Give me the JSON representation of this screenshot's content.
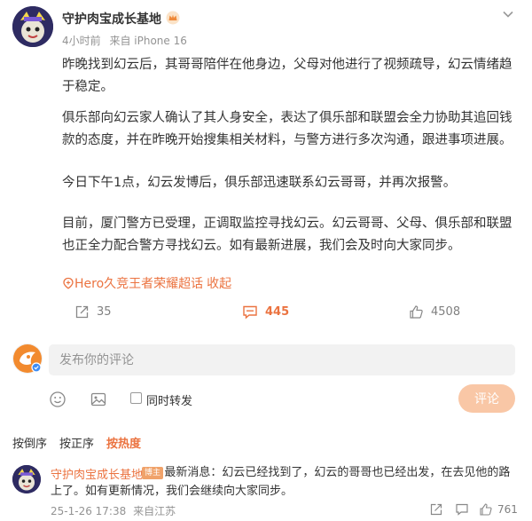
{
  "post": {
    "author": "守护肉宝成长基地",
    "time": "4小时前",
    "source": "来自 iPhone 16",
    "paragraphs": [
      "昨晚找到幻云后，其哥哥陪伴在他身边，父母对他进行了视频疏导，幻云情绪趋于稳定。",
      "俱乐部向幻云家人确认了其人身安全，表达了俱乐部和联盟会全力协助其追回钱款的态度，并在昨晚开始搜集相关材料，与警方进行多次沟通，跟进事项进展。",
      "今日下午1点，幻云发博后，俱乐部迅速联系幻云哥哥，并再次报警。",
      "目前，厦门警方已受理，正调取监控寻找幻云。幻云哥哥、父母、俱乐部和联盟也正全力配合警方寻找幻云。如有最新进展，我们会及时向大家同步。"
    ],
    "topic": "Hero久竞王者荣耀超话",
    "collapse_label": "收起",
    "repost_count": "35",
    "comment_count": "445",
    "like_count": "4508"
  },
  "composer": {
    "placeholder": "发布你的评论",
    "repost_option": "同时转发",
    "submit_label": "评论"
  },
  "sort": {
    "options": [
      "按倒序",
      "按正序",
      "按热度"
    ],
    "active": "按热度"
  },
  "comment": {
    "author": "守护肉宝成长基地",
    "badge": "博主",
    "text": ":最新消息：幻云已经找到了，幻云的哥哥也已经出发，在去见他的路上了。如有更新情况，我们会继续向大家同步。",
    "date": "25-1-26 17:38",
    "location": "来自江苏",
    "like_count": "761"
  },
  "colors": {
    "accent": "#eb7340",
    "muted": "#939393",
    "submit_disabled": "#f9c7a6",
    "input_bg": "#f2f2f2"
  },
  "icons": [
    "crown-icon",
    "chevron-down-icon",
    "topic-icon",
    "repost-icon",
    "comment-icon",
    "like-icon",
    "emoji-icon",
    "image-icon",
    "share-icon",
    "reply-icon"
  ]
}
